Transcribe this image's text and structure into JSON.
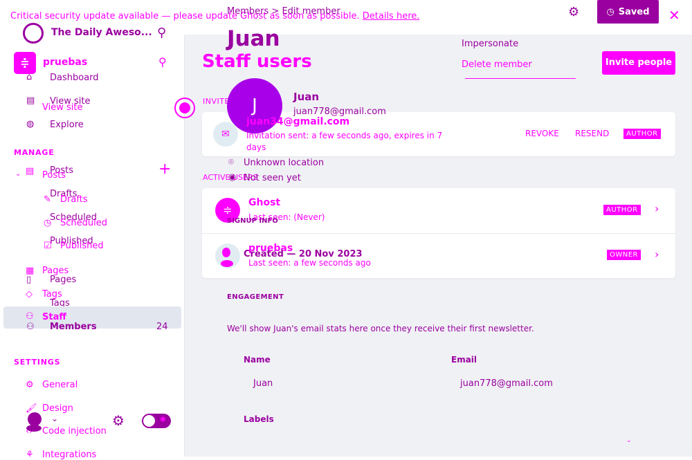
{
  "banner": {
    "text": "Critical security update available — please update Ghost as soon as possible.",
    "link": "Details here."
  },
  "breadcrumb": {
    "parent": "Members",
    "separator": ">",
    "current": "Edit member"
  },
  "header": {
    "saved_label": "Saved"
  },
  "site": {
    "name": "The Daily Aweso...",
    "name2": "pruebas"
  },
  "nav_back": {
    "dashboard": "Dashboard",
    "view_site": "View site",
    "explore": "Explore",
    "posts": "Posts",
    "drafts": "Drafts",
    "scheduled": "Scheduled",
    "published": "Published",
    "pages": "Pages",
    "tags": "Tags",
    "members": "Members",
    "members_count": "24"
  },
  "nav_front": {
    "view_site": "View site",
    "manage": "MANAGE",
    "posts": "Posts",
    "drafts": "Drafts",
    "scheduled": "Scheduled",
    "published": "Published",
    "pages": "Pages",
    "tags": "Tags",
    "staff": "Staff",
    "settings": "SETTINGS",
    "general": "General",
    "design": "Design",
    "code_injection": "Code injection",
    "integrations": "Integrations"
  },
  "member": {
    "title": "Juan",
    "initial": "J",
    "name": "Juan",
    "email": "juan778@gmail.com",
    "location": "Unknown location",
    "seen": "Not seen yet",
    "signup_heading": "SIGNUP INFO",
    "created": "Created — 20 Nov 2023",
    "engagement_heading": "ENGAGEMENT",
    "engagement_text": "We'll show Juan's email stats here once they receive their first newsletter.",
    "name_label": "Name",
    "name_value": "Juan",
    "email_label": "Email",
    "email_value": "juan778@gmail.com",
    "labels_label": "Labels"
  },
  "menu": {
    "impersonate": "Impersonate",
    "delete": "Delete member"
  },
  "staff": {
    "title": "Staff users",
    "invite_button": "Invite people",
    "invited_heading": "INVITED USERS",
    "invite": {
      "email": "juan34@gmail.com",
      "status": "Invitation sent: a few seconds ago, expires in 7 days",
      "revoke": "REVOKE",
      "resend": "RESEND",
      "role": "AUTHOR"
    },
    "active_heading": "ACTIVE USERS",
    "users": [
      {
        "name": "Ghost",
        "last_seen": "Last seen: (Never)",
        "role": "AUTHOR"
      },
      {
        "name": "pruebas",
        "last_seen": "Last seen: a few seconds ago",
        "role": "OWNER"
      }
    ]
  },
  "colors": {
    "magenta": "#ff00ff",
    "purple": "#9a009f",
    "avatar": "#a800e8",
    "background": "#f0f1f5"
  }
}
